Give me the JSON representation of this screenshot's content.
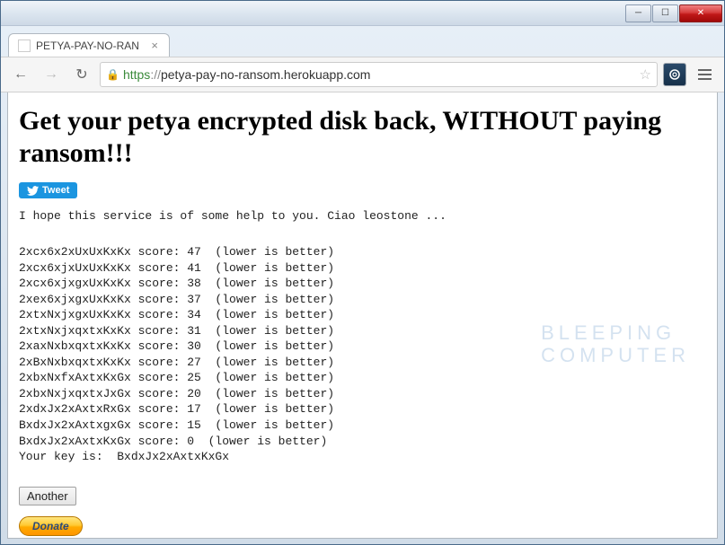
{
  "window": {
    "minimize": "─",
    "maximize": "☐",
    "close": "✕"
  },
  "tab": {
    "title": "PETYA-PAY-NO-RAN",
    "close": "×"
  },
  "toolbar": {
    "back": "←",
    "forward": "→",
    "reload": "↻",
    "lock": "🔒",
    "url_scheme": "https",
    "url_sep": "://",
    "url_host": "petya-pay-no-ransom.herokuapp.com",
    "star": "☆",
    "menu": "≡"
  },
  "page": {
    "heading": "Get your petya encrypted disk back, WITHOUT paying ransom!!!",
    "tweet_label": "Tweet",
    "intro": "I hope this service is of some help to you. Ciao leostone ...",
    "results": [
      {
        "key": "2xcx6x2xUxUxKxKx",
        "score": 47,
        "hint": "(lower is better)"
      },
      {
        "key": "2xcx6xjxUxUxKxKx",
        "score": 41,
        "hint": "(lower is better)"
      },
      {
        "key": "2xcx6xjxgxUxKxKx",
        "score": 38,
        "hint": "(lower is better)"
      },
      {
        "key": "2xex6xjxgxUxKxKx",
        "score": 37,
        "hint": "(lower is better)"
      },
      {
        "key": "2xtxNxjxgxUxKxKx",
        "score": 34,
        "hint": "(lower is better)"
      },
      {
        "key": "2xtxNxjxqxtxKxKx",
        "score": 31,
        "hint": "(lower is better)"
      },
      {
        "key": "2xaxNxbxqxtxKxKx",
        "score": 30,
        "hint": "(lower is better)"
      },
      {
        "key": "2xBxNxbxqxtxKxKx",
        "score": 27,
        "hint": "(lower is better)"
      },
      {
        "key": "2xbxNxfxAxtxKxGx",
        "score": 25,
        "hint": "(lower is better)"
      },
      {
        "key": "2xbxNxjxqxtxJxGx",
        "score": 20,
        "hint": "(lower is better)"
      },
      {
        "key": "2xdxJx2xAxtxRxGx",
        "score": 17,
        "hint": "(lower is better)"
      },
      {
        "key": "BxdxJx2xAxtxgxGx",
        "score": 15,
        "hint": "(lower is better)"
      },
      {
        "key": "BxdxJx2xAxtxKxGx",
        "score": 0,
        "hint": "(lower is better)"
      }
    ],
    "final_key_label": "Your key is:  ",
    "final_key": "BxdxJx2xAxtxKxGx",
    "another_label": "Another",
    "donate_label": "Donate"
  },
  "watermark": {
    "line1": "BLEEPING",
    "line2": "COMPUTER"
  }
}
